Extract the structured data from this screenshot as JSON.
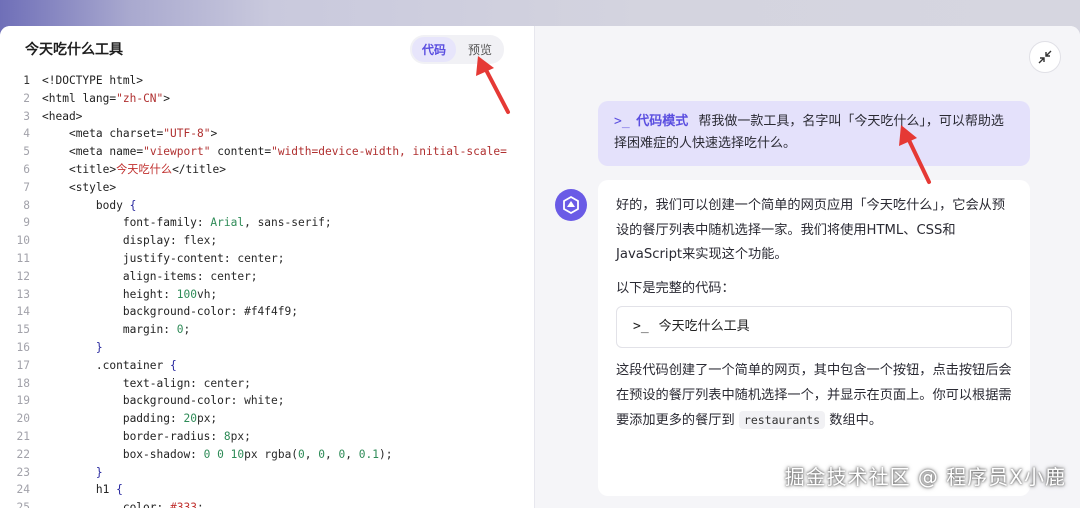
{
  "code_panel": {
    "title": "今天吃什么工具",
    "tabs": [
      {
        "label": "代码",
        "active": true
      },
      {
        "label": "预览",
        "active": false
      }
    ],
    "lines": [
      {
        "n": "1",
        "html": "<span class=\"tg\">&lt;!DOCTYPE html&gt;</span>"
      },
      {
        "n": "2",
        "html": "<span class=\"tg\">&lt;html</span> <span class=\"at\">lang=</span><span class=\"st\">\"zh-CN\"</span><span class=\"tg\">&gt;</span>"
      },
      {
        "n": "3",
        "html": "<span class=\"tg\">&lt;head&gt;</span>"
      },
      {
        "n": "4",
        "html": "    <span class=\"tg\">&lt;meta</span> <span class=\"at\">charset=</span><span class=\"st\">\"UTF-8\"</span><span class=\"tg\">&gt;</span>"
      },
      {
        "n": "5",
        "html": "    <span class=\"tg\">&lt;meta</span> <span class=\"at\">name=</span><span class=\"st\">\"viewport\"</span> <span class=\"at\">content=</span><span class=\"st\">\"width=device-width, initial-scale=</span>"
      },
      {
        "n": "6",
        "html": "    <span class=\"tg\">&lt;title&gt;</span><span class=\"ch\">今天吃什么</span><span class=\"tg\">&lt;/title&gt;</span>"
      },
      {
        "n": "7",
        "html": "    <span class=\"tg\">&lt;style&gt;</span>"
      },
      {
        "n": "8",
        "html": "        <span class=\"pr\">body</span> <span class=\"kw\">{</span>"
      },
      {
        "n": "9",
        "html": "            <span class=\"pr\">font-family:</span> <span class=\"vl\">Arial</span>, sans-serif;"
      },
      {
        "n": "10",
        "html": "            <span class=\"pr\">display:</span> flex;"
      },
      {
        "n": "11",
        "html": "            <span class=\"pr\">justify-content:</span> center;"
      },
      {
        "n": "12",
        "html": "            <span class=\"pr\">align-items:</span> center;"
      },
      {
        "n": "13",
        "html": "            <span class=\"pr\">height:</span> <span class=\"nm\">100</span>vh;"
      },
      {
        "n": "14",
        "html": "            <span class=\"pr\">background-color:</span> #f4f4f9;"
      },
      {
        "n": "15",
        "html": "            <span class=\"pr\">margin:</span> <span class=\"nm\">0</span>;"
      },
      {
        "n": "16",
        "html": "        <span class=\"kw\">}</span>"
      },
      {
        "n": "17",
        "html": "        <span class=\"pr\">.container</span> <span class=\"kw\">{</span>"
      },
      {
        "n": "18",
        "html": "            <span class=\"pr\">text-align:</span> center;"
      },
      {
        "n": "19",
        "html": "            <span class=\"pr\">background-color:</span> white;"
      },
      {
        "n": "20",
        "html": "            <span class=\"pr\">padding:</span> <span class=\"nm\">20</span>px;"
      },
      {
        "n": "21",
        "html": "            <span class=\"pr\">border-radius:</span> <span class=\"nm\">8</span>px;"
      },
      {
        "n": "22",
        "html": "            <span class=\"pr\">box-shadow:</span> <span class=\"nm\">0</span> <span class=\"nm\">0</span> <span class=\"nm\">10</span>px rgba(<span class=\"nm\">0</span>, <span class=\"nm\">0</span>, <span class=\"nm\">0</span>, <span class=\"nm\">0.1</span>);"
      },
      {
        "n": "23",
        "html": "        <span class=\"kw\">}</span>"
      },
      {
        "n": "24",
        "html": "        <span class=\"pr\">h1</span> <span class=\"kw\">{</span>"
      },
      {
        "n": "25",
        "html": "            <span class=\"pr\">color:</span> <span class=\"ch\">#333</span>;"
      }
    ]
  },
  "chat": {
    "user_message": {
      "mode_icon": ">_",
      "mode_label": "代码模式",
      "text": "帮我做一款工具，名字叫「今天吃什么」，可以帮助选择困难症的人快速选择吃什么。"
    },
    "assistant": {
      "para1": "好的，我们可以创建一个简单的网页应用「今天吃什么」，它会从预设的餐厅列表中随机选择一家。我们将使用HTML、CSS和JavaScript来实现这个功能。",
      "para2": "以下是完整的代码：",
      "chip_icon": ">_",
      "chip_label": "今天吃什么工具",
      "para3_before": "这段代码创建了一个简单的网页，其中包含一个按钮，点击按钮后会在预设的餐厅列表中随机选择一个，并显示在页面上。你可以根据需要添加更多的餐厅到",
      "para3_code": "restaurants",
      "para3_after": "数组中。"
    }
  },
  "watermark": "掘金技术社区 @ 程序员X小鹿",
  "colors": {
    "accent": "#5b4fe0",
    "arrow": "#e53935",
    "user_bubble": "#e4e1fb"
  }
}
